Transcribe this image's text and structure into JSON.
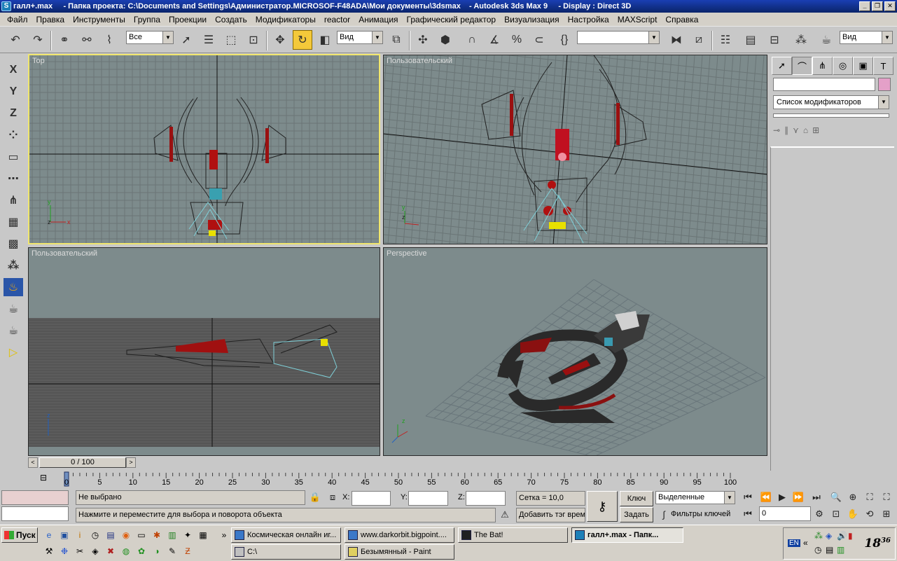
{
  "window": {
    "title": "галл+.max     - Папка проекта: C:\\Documents and Settings\\Администратор.MICROSOF-F48ADA\\Мои документы\\3dsmax    - Autodesk 3ds Max 9     - Display : Direct 3D",
    "minimize": "_",
    "maximize": "❐",
    "close": "✕"
  },
  "menu": [
    "Файл",
    "Правка",
    "Инструменты",
    "Группа",
    "Проекции",
    "Создать",
    "Модификаторы",
    "reactor",
    "Анимация",
    "Графический редактор",
    "Визуализация",
    "Настройка",
    "MAXScript",
    "Справка"
  ],
  "toolbar": {
    "selection_filter": "Все",
    "reference_coord": "Вид",
    "named_selection": "",
    "view_right": "Вид"
  },
  "viewports": {
    "top_left": "Top",
    "top_right": "Пользовательский",
    "bottom_left": "Пользовательский",
    "bottom_right": "Perspective"
  },
  "command_panel": {
    "object_name": "",
    "modifier_list": "Список модификаторов",
    "object_color": "#e4a0c8"
  },
  "time_slider": {
    "position": "0 / 100",
    "prev": "<",
    "next": ">"
  },
  "trackbar": {
    "ticks": [
      "0",
      "5",
      "10",
      "15",
      "20",
      "25",
      "30",
      "35",
      "40",
      "45",
      "50",
      "55",
      "60",
      "65",
      "70",
      "75",
      "80",
      "85",
      "90",
      "95",
      "100"
    ]
  },
  "status": {
    "selection": "Не выбрано",
    "prompt": "Нажмите и переместите для выбора и поворота объекта",
    "x_label": "X:",
    "y_label": "Y:",
    "z_label": "Z:",
    "x_value": "",
    "y_value": "",
    "z_value": "",
    "grid": "Сетка = 10,0",
    "add_time_tag": "Добавить тэг врем",
    "key_button": "Ключ",
    "set_key_button": "Задать",
    "key_mode": "Выделенные",
    "key_filters": "Фильтры ключей",
    "frame_value": "0"
  },
  "taskbar": {
    "start": "Пуск",
    "tasks_row1": [
      "Космическая онлайн иг...",
      "www.darkorbit.bigpoint....",
      "The Bat!",
      "галл+.max     - Папк..."
    ],
    "tasks_row2": [
      "C:\\",
      "Безымянный - Paint"
    ],
    "lang": "EN",
    "clock_hour": "18",
    "clock_min": "36"
  }
}
